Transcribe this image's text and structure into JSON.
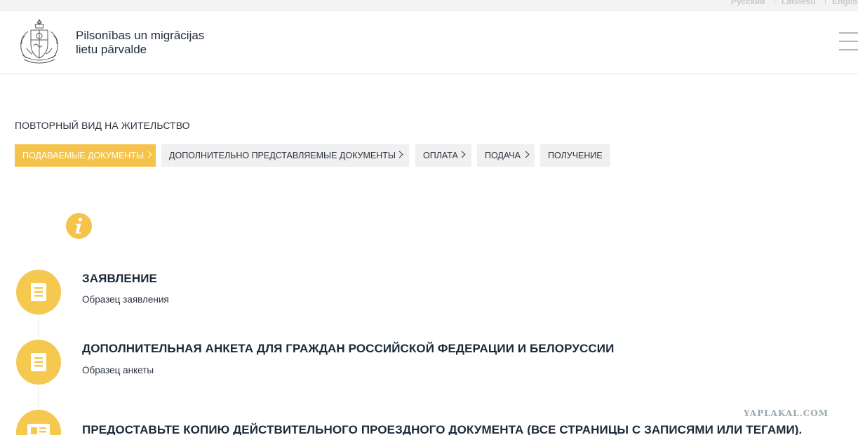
{
  "languages": [
    "Русский",
    "Latviešu",
    "English"
  ],
  "header": {
    "org_name_line1": "Pilsonības un migrācijas",
    "org_name_line2": "lietu pārvalde"
  },
  "page_title": "ПОВТОРНЫЙ ВИД НА ЖИТЕЛЬСТВО",
  "tabs": [
    {
      "label": "ПОДАВАЕМЫЕ ДОКУМЕНТЫ",
      "active": true
    },
    {
      "label": "ДОПОЛНИТЕЛЬНО ПРЕДСТАВЛЯЕМЫЕ ДОКУМЕНТЫ",
      "active": false
    },
    {
      "label": "ОПЛАТА",
      "active": false
    },
    {
      "label": "ПОДАЧА",
      "active": false
    },
    {
      "label": "ПОЛУЧЕНИЕ",
      "active": false
    }
  ],
  "documents": [
    {
      "title": "ЗАЯВЛЕНИЕ",
      "subtitle": "Образец заявления",
      "icon": "document-icon"
    },
    {
      "title": "ДОПОЛНИТЕЛЬНАЯ АНКЕТА ДЛЯ ГРАЖДАН РОССИЙСКОЙ ФЕДЕРАЦИИ И БЕЛОРУССИИ",
      "subtitle": "Образец анкеты",
      "icon": "document-icon"
    },
    {
      "title": "ПРЕДОСТАВЬТЕ КОПИЮ ДЕЙСТВИТЕЛЬНОГО ПРОЕЗДНОГО ДОКУМЕНТА (ВСЕ СТРАНИЦЫ С ЗАПИСЯМИ ИЛИ ТЕГАМИ).",
      "subtitle": "",
      "icon": "id-card-icon"
    }
  ],
  "watermark": "YAPLAKAL.COM",
  "colors": {
    "accent": "#f5c34b",
    "tab_bg": "#f0f0f0",
    "text": "#1b2a3a"
  }
}
